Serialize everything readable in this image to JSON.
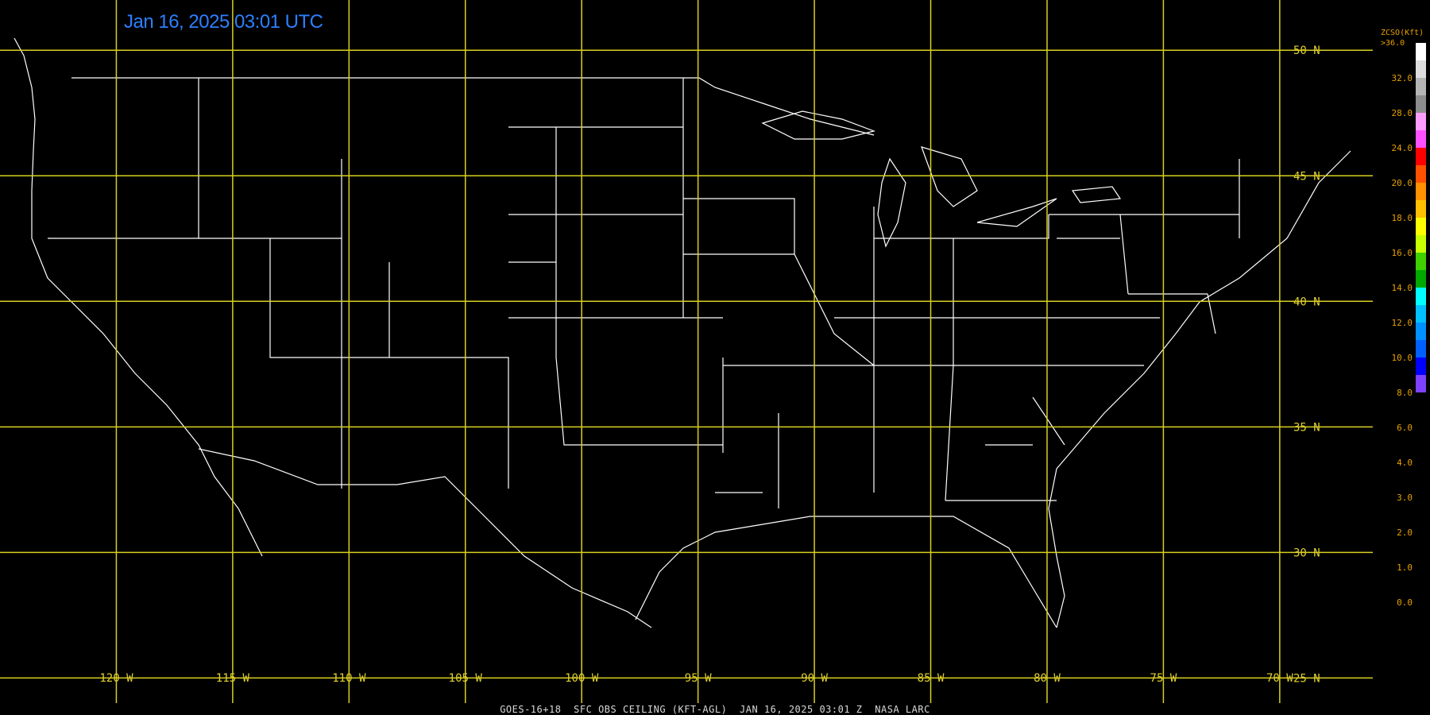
{
  "timestamp": "Jan 16, 2025 03:01 UTC",
  "footer": {
    "product": "GOES-16+18",
    "field": "SFC OBS CEILING (KFT-AGL)",
    "time": "JAN 16, 2025 03:01 Z",
    "source": "NASA LARC"
  },
  "legend": {
    "title": "ZCSO(Kft)",
    "max_label": ">36.0",
    "ticks": [
      "32.0",
      "28.0",
      "24.0",
      "20.0",
      "18.0",
      "16.0",
      "14.0",
      "12.0",
      "10.0",
      "8.0",
      "6.0",
      "4.0",
      "3.0",
      "2.0",
      "1.0",
      "0.0"
    ],
    "colors": [
      "#ffffff",
      "#dcdcdc",
      "#b4b4b4",
      "#8c8c8c",
      "#ff9cff",
      "#ff50ff",
      "#ff0000",
      "#ff5000",
      "#ff9000",
      "#ffc000",
      "#ffff00",
      "#c8ff00",
      "#40d000",
      "#00a800",
      "#00ffff",
      "#00c0ff",
      "#0090ff",
      "#0060ff",
      "#0000ff",
      "#8040ff"
    ]
  },
  "map": {
    "lon_range": [
      -125,
      -66
    ],
    "lat_range": [
      24,
      52
    ],
    "lat_lines": [
      50,
      45,
      40,
      35,
      30,
      25
    ],
    "lon_lines": [
      -120,
      -115,
      -110,
      -105,
      -100,
      -95,
      -90,
      -85,
      -80,
      -75,
      -70
    ],
    "lat_labels": [
      "50 N",
      "45 N",
      "40 N",
      "35 N",
      "30 N",
      "25 N"
    ],
    "lon_labels": [
      "120 W",
      "115 W",
      "110 W",
      "105 W",
      "100 W",
      "95 W",
      "90 W",
      "85 W",
      "80 W",
      "75 W",
      "70 W"
    ],
    "grid_color": "#d8d020",
    "label_color": "#e0d030",
    "boundary_color": "#ffffff"
  }
}
